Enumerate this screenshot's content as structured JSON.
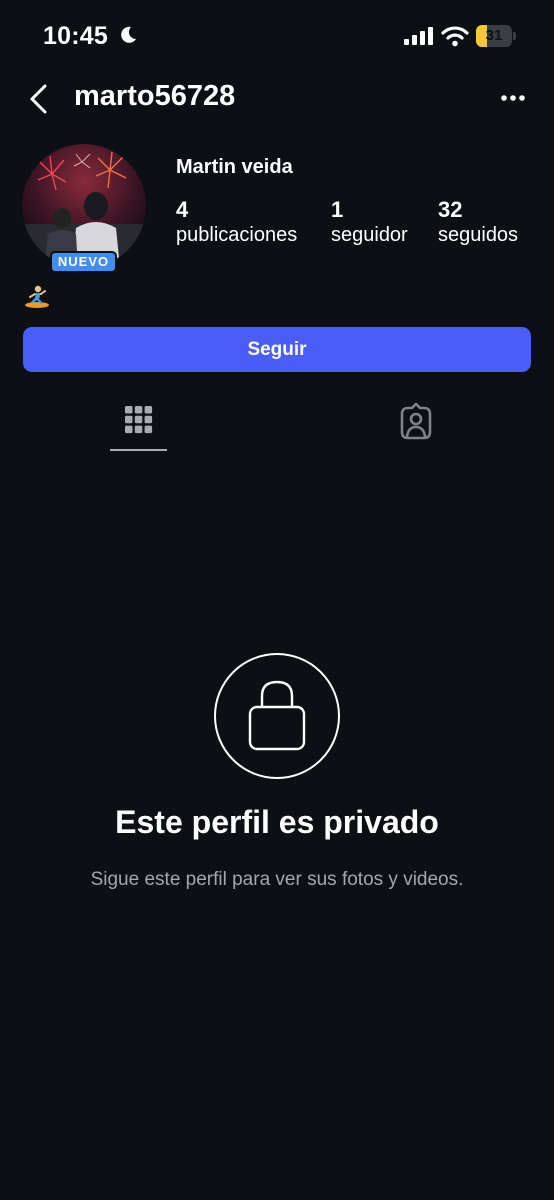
{
  "status_bar": {
    "time": "10:45",
    "battery_level": "31",
    "battery_fraction": 0.31,
    "battery_color": "#f5c73a",
    "icons": [
      "moon-icon",
      "signal-icon",
      "wifi-icon",
      "battery-icon"
    ]
  },
  "header": {
    "username": "marto56728",
    "icons": [
      "back-icon",
      "more-icon"
    ]
  },
  "profile": {
    "full_name": "Martin veida",
    "badge": "NUEVO",
    "bio_emoji": "surfer-icon",
    "stats": [
      {
        "value": "4",
        "label": "publicaciones"
      },
      {
        "value": "1",
        "label": "seguidor"
      },
      {
        "value": "32",
        "label": "seguidos"
      }
    ]
  },
  "actions": {
    "follow_label": "Seguir",
    "follow_color": "#4a5ef7"
  },
  "tabs": [
    {
      "icon": "grid-icon",
      "selected": true
    },
    {
      "icon": "tagged-person-icon",
      "selected": false
    }
  ],
  "private_notice": {
    "icon": "lock-icon",
    "title": "Este perfil es privado",
    "subtitle": "Sigue este perfil para ver sus fotos y videos."
  },
  "colors": {
    "background": "#0c0f14",
    "badge": "#3f8ef0",
    "muted_text": "#a3a7ae"
  }
}
